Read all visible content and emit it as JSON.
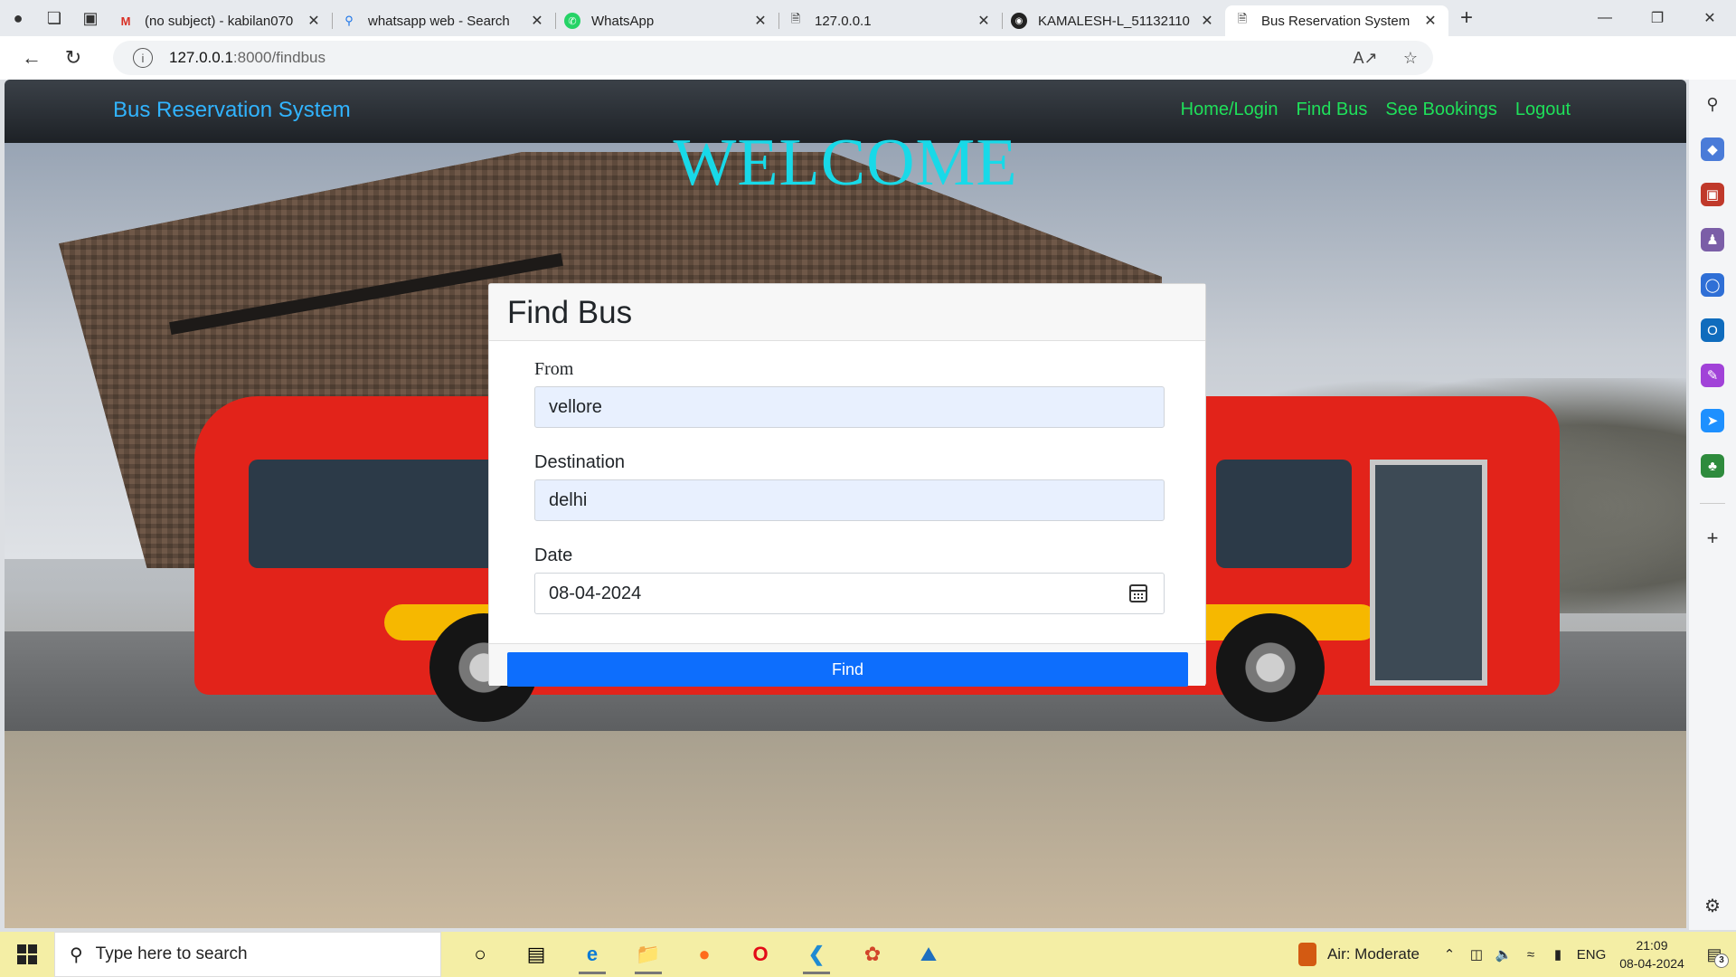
{
  "browser": {
    "tabs": [
      {
        "title": "(no subject) - kabilan070",
        "icon": "gmail-icon",
        "active": false
      },
      {
        "title": "whatsapp web - Search",
        "icon": "search-icon",
        "active": false
      },
      {
        "title": "WhatsApp",
        "icon": "whatsapp-icon",
        "active": false
      },
      {
        "title": "127.0.0.1",
        "icon": "page-icon",
        "active": false
      },
      {
        "title": "KAMALESH-L_51132110",
        "icon": "github-icon",
        "active": false
      },
      {
        "title": "Bus Reservation System",
        "icon": "page-icon",
        "active": true
      }
    ],
    "url_host": "127.0.0.1",
    "url_path": ":8000/findbus"
  },
  "navbar": {
    "brand": "Bus Reservation System",
    "links": [
      "Home/Login",
      "Find Bus",
      "See Bookings",
      "Logout"
    ]
  },
  "hero": {
    "welcome": "WELCOME"
  },
  "form": {
    "title": "Find Bus",
    "from_label": "From",
    "from_value": "vellore",
    "destination_label": "Destination",
    "destination_value": "delhi",
    "date_label": "Date",
    "date_value": "08-04-2024",
    "submit_label": "Find"
  },
  "taskbar": {
    "search_placeholder": "Type here to search",
    "weather": "Air: Moderate",
    "language": "ENG",
    "time": "21:09",
    "date": "08-04-2024",
    "notification_count": "3"
  }
}
